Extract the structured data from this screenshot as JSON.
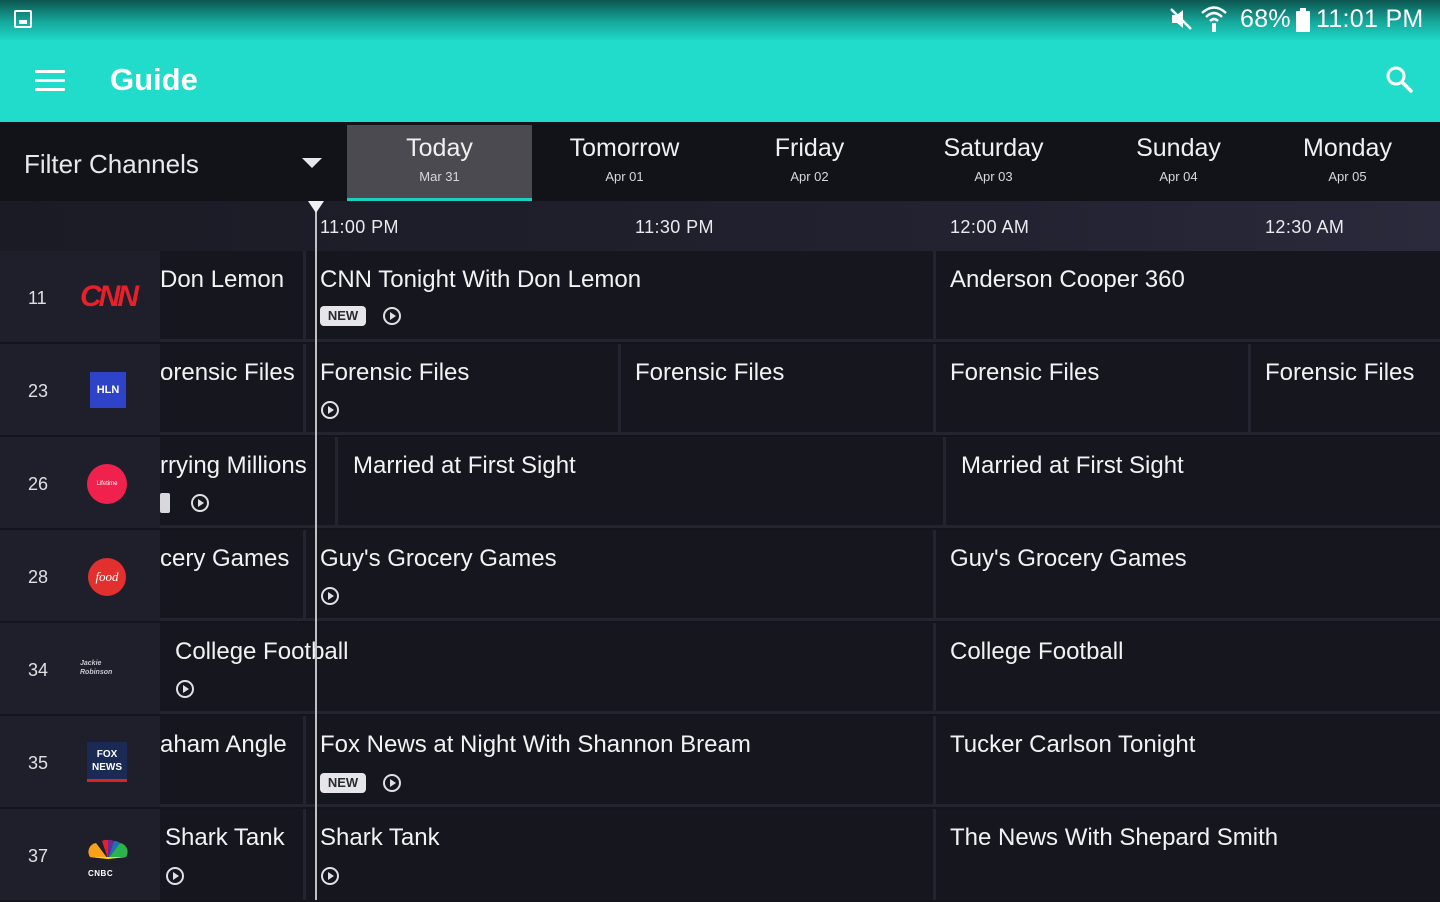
{
  "status_bar": {
    "battery": "68%",
    "time": "11:01 PM"
  },
  "app_bar": {
    "title": "Guide"
  },
  "filter": {
    "label": "Filter Channels"
  },
  "days": [
    {
      "name": "Today",
      "date": "Mar 31"
    },
    {
      "name": "Tomorrow",
      "date": "Apr 01"
    },
    {
      "name": "Friday",
      "date": "Apr 02"
    },
    {
      "name": "Saturday",
      "date": "Apr 03"
    },
    {
      "name": "Sunday",
      "date": "Apr 04"
    },
    {
      "name": "Monday",
      "date": "Apr 05"
    }
  ],
  "times": [
    "11:00 PM",
    "11:30 PM",
    "12:00 AM",
    "12:30 AM"
  ],
  "channels": [
    {
      "number": "11",
      "logo": "cnn-logo",
      "logo_text": "CNN",
      "color": "#e8202a"
    },
    {
      "number": "23",
      "logo": "hln-logo",
      "logo_text": "HLN",
      "color": "#2e43c8"
    },
    {
      "number": "26",
      "logo": "lifetime-logo",
      "logo_text": "Lifetime",
      "color": "#f0214c"
    },
    {
      "number": "28",
      "logo": "food-network-logo",
      "logo_text": "food",
      "color": "#e2302f"
    },
    {
      "number": "34",
      "logo": "jackie-robinson-logo",
      "logo_text": "Jackie Robinson",
      "color": "#c8c8d0"
    },
    {
      "number": "35",
      "logo": "fox-news-logo",
      "logo_text": "FOX NEWS",
      "color": "#d22"
    },
    {
      "number": "37",
      "logo": "cnbc-logo",
      "logo_text": "CNBC",
      "color": "#ffffff"
    }
  ],
  "programs": {
    "r0": [
      "Don Lemon",
      "CNN Tonight With Don Lemon",
      "Anderson Cooper 360"
    ],
    "r1": [
      "orensic Files",
      "Forensic Files",
      "Forensic Files",
      "Forensic Files",
      "Forensic Files"
    ],
    "r2": [
      "rrying Millions",
      "Married at First Sight",
      "Married at First Sight"
    ],
    "r3": [
      "cery Games",
      "Guy's Grocery Games",
      "Guy's Grocery Games"
    ],
    "r4": [
      "College Football",
      "College Football"
    ],
    "r5": [
      "aham Angle",
      "Fox News at Night With Shannon Bream",
      "Tucker Carlson Tonight"
    ],
    "r6": [
      "Shark Tank",
      "Shark Tank",
      "The News With Shepard Smith"
    ]
  },
  "badge_new": "NEW"
}
